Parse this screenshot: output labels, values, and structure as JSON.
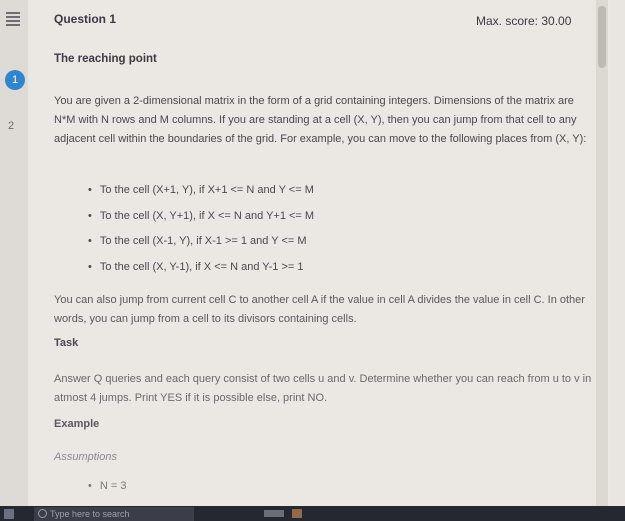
{
  "nav": {
    "items": [
      "1",
      "2"
    ]
  },
  "header": {
    "question": "Question 1",
    "max_score": "Max. score: 30.00"
  },
  "problem": {
    "title": "The reaching point",
    "intro": "You are given a 2-dimensional matrix in the form of a grid containing integers. Dimensions of the matrix are N*M with N rows and M columns. If you are standing at a cell (X, Y), then you can jump from that cell to any adjacent cell within the boundaries of the grid. For example, you can move to the following places from (X, Y):",
    "moves": [
      "To the cell (X+1, Y), if X+1 <= N and Y <= M",
      "To the cell (X, Y+1), if X <= N and Y+1 <= M",
      "To the cell (X-1, Y), if X-1 >= 1 and Y <= M",
      "To the cell (X, Y-1), if X <= N and Y-1 >= 1"
    ],
    "jump_rule": "You can also jump from current cell C to another cell A if the value in cell A divides the value in cell C. In other words, you can jump from a cell to its divisors containing cells.",
    "task_heading": "Task",
    "task_text": "Answer Q queries and each query consist of two cells u and v. Determine whether you can reach from u to v in atmost 4 jumps. Print YES if it is possible else, print NO.",
    "example_heading": "Example",
    "assumptions_heading": "Assumptions",
    "assumption_n": "N = 3"
  },
  "taskbar": {
    "search_placeholder": "Type here to search"
  }
}
